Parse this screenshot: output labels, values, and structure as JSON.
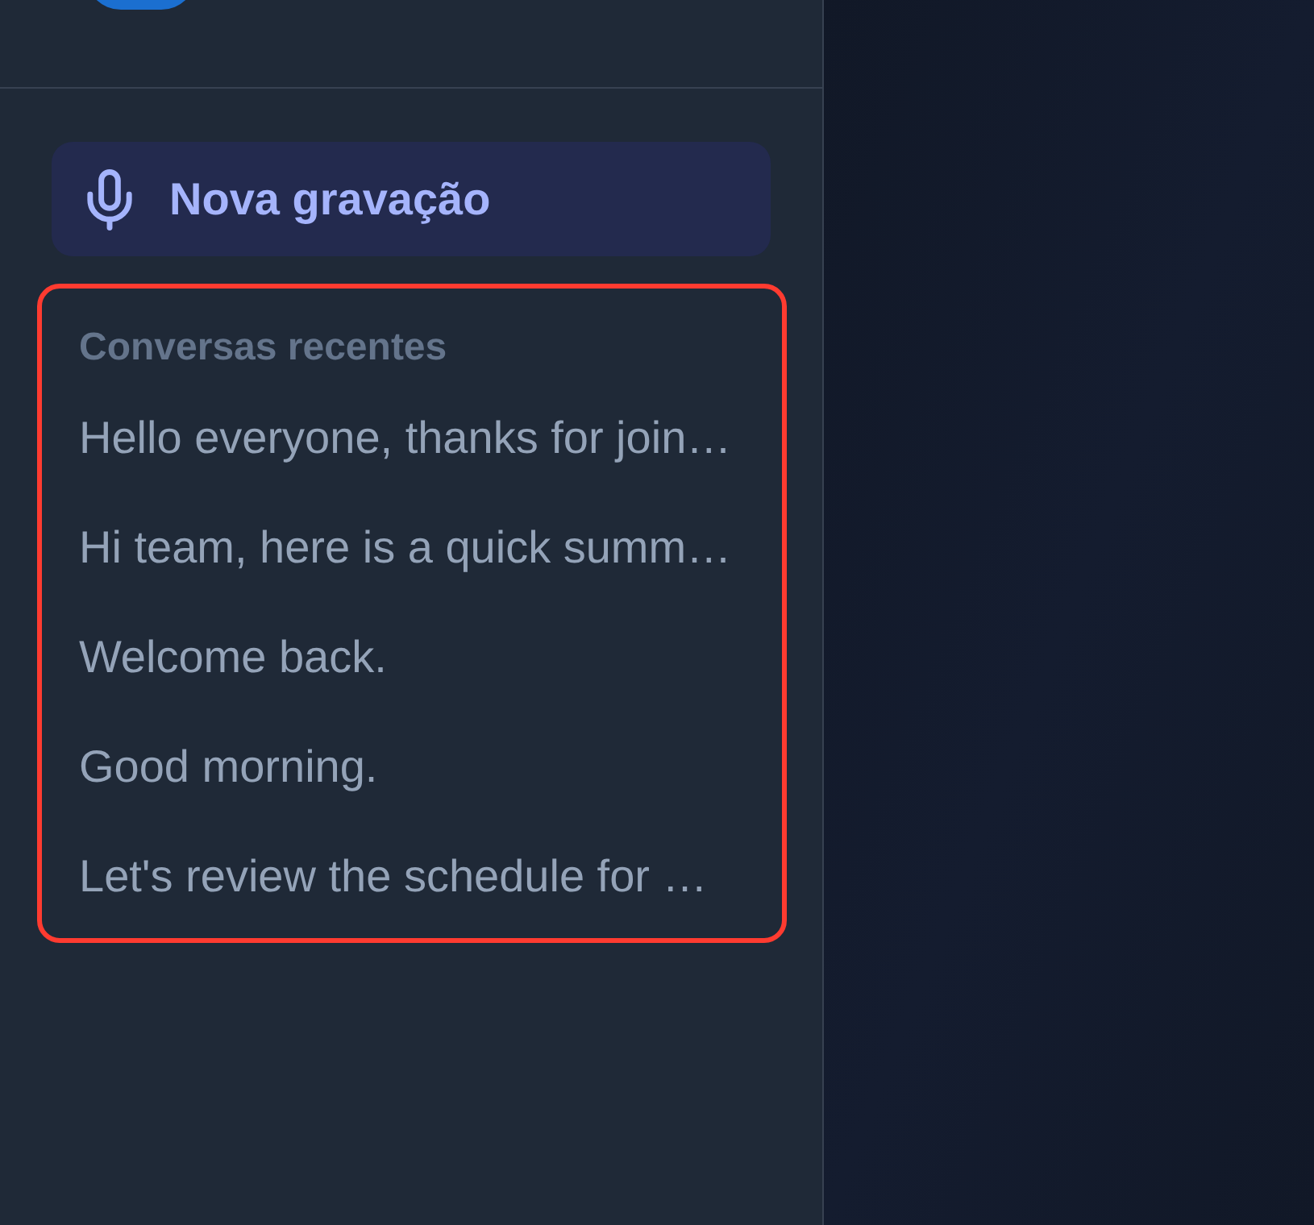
{
  "new_recording": {
    "label": "Nova gravação"
  },
  "recent_conversations": {
    "title": "Conversas recentes",
    "highlighted": true,
    "items": [
      {
        "label": "Hello everyone, thanks for join…"
      },
      {
        "label": "Hi team, here is a quick summ…"
      },
      {
        "label": "Welcome back."
      },
      {
        "label": "Good morning."
      },
      {
        "label": "Let's review the schedule for …"
      }
    ]
  }
}
